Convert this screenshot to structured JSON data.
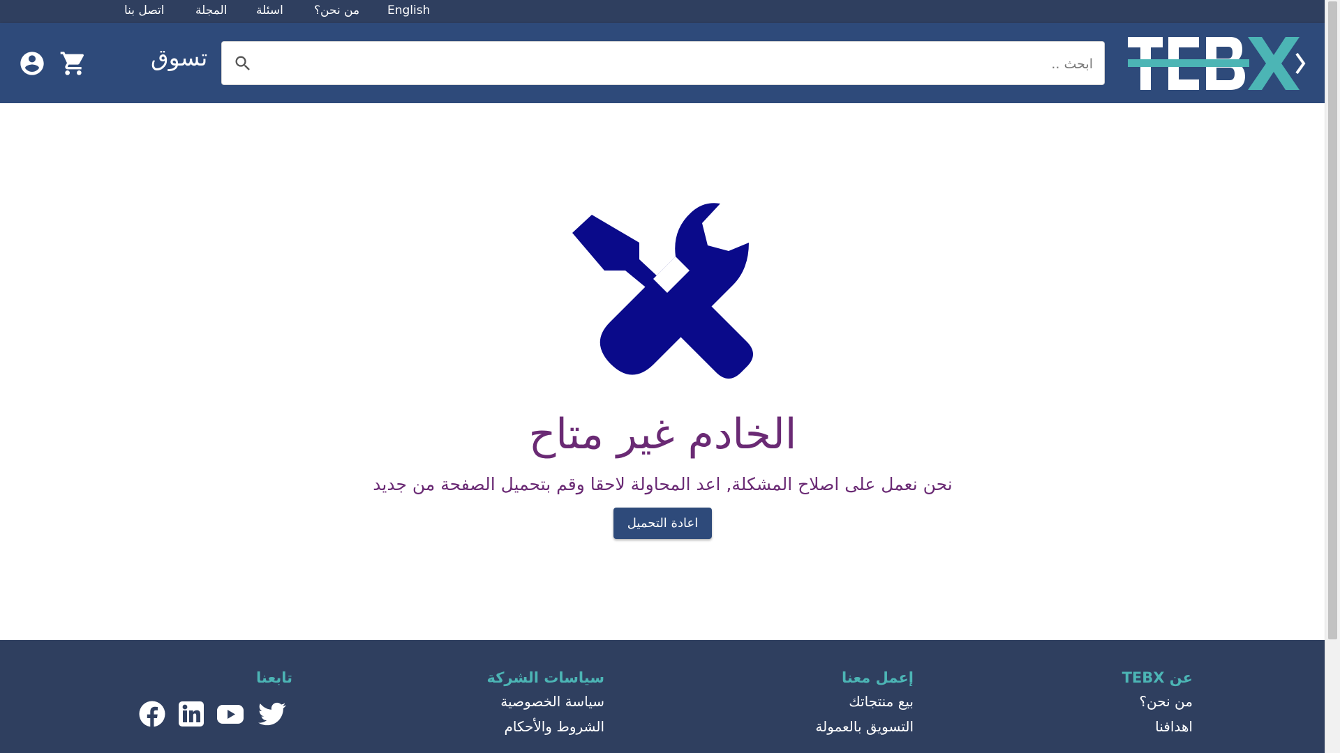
{
  "topbar": {
    "links": [
      "English",
      "من نحن؟",
      "اسئلة",
      "المجلة",
      "اتصل بنا"
    ]
  },
  "header": {
    "shop_label": "تسوق",
    "search_placeholder": "ابحث ..",
    "logo_text": "TEBX",
    "icons": [
      "account-circle-icon",
      "shopping-cart-icon",
      "search-icon"
    ]
  },
  "main": {
    "icon": "tools-icon",
    "title": "الخادم غير متاح",
    "description": "نحن نعمل على اصلاح المشكلة, اعد المحاولة لاحقا وقم بتحميل الصفحة من جديد",
    "reload_label": "اعادة التحميل"
  },
  "footer": {
    "about": {
      "heading": "عن TEBX",
      "links": [
        "من نحن؟",
        "اهدافنا"
      ]
    },
    "work": {
      "heading": "إعمل معنا",
      "links": [
        "بيع منتجاتك",
        "التسويق بالعمولة"
      ]
    },
    "policies": {
      "heading": "سياسات الشركة",
      "links": [
        "سياسة الخصوصية",
        "الشروط والأحكام"
      ]
    },
    "follow": {
      "heading": "تابعنا",
      "icons": [
        "facebook-icon",
        "linkedin-icon",
        "youtube-icon",
        "twitter-icon"
      ]
    }
  },
  "colors": {
    "topbar": "#2f3f5f",
    "header": "#2e4a7a",
    "accent": "#4cb5b5",
    "title": "#6a2a74",
    "icon": "#0a0a8a"
  }
}
